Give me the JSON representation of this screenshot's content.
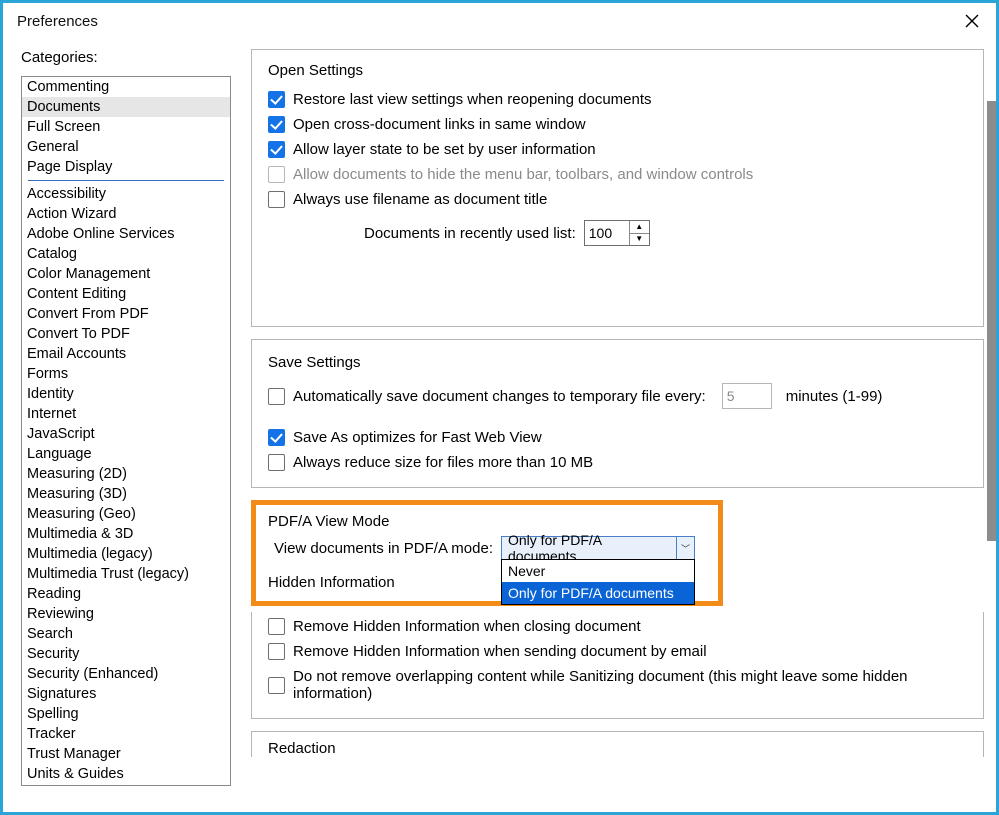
{
  "window": {
    "title": "Preferences"
  },
  "categories": {
    "label": "Categories:",
    "primary": [
      {
        "label": "Commenting"
      },
      {
        "label": "Documents",
        "selected": true
      },
      {
        "label": "Full Screen"
      },
      {
        "label": "General"
      },
      {
        "label": "Page Display"
      }
    ],
    "secondary": [
      {
        "label": "Accessibility"
      },
      {
        "label": "Action Wizard"
      },
      {
        "label": "Adobe Online Services"
      },
      {
        "label": "Catalog"
      },
      {
        "label": "Color Management"
      },
      {
        "label": "Content Editing"
      },
      {
        "label": "Convert From PDF"
      },
      {
        "label": "Convert To PDF"
      },
      {
        "label": "Email Accounts"
      },
      {
        "label": "Forms"
      },
      {
        "label": "Identity"
      },
      {
        "label": "Internet"
      },
      {
        "label": "JavaScript"
      },
      {
        "label": "Language"
      },
      {
        "label": "Measuring (2D)"
      },
      {
        "label": "Measuring (3D)"
      },
      {
        "label": "Measuring (Geo)"
      },
      {
        "label": "Multimedia & 3D"
      },
      {
        "label": "Multimedia (legacy)"
      },
      {
        "label": "Multimedia Trust (legacy)"
      },
      {
        "label": "Reading"
      },
      {
        "label": "Reviewing"
      },
      {
        "label": "Search"
      },
      {
        "label": "Security"
      },
      {
        "label": "Security (Enhanced)"
      },
      {
        "label": "Signatures"
      },
      {
        "label": "Spelling"
      },
      {
        "label": "Tracker"
      },
      {
        "label": "Trust Manager"
      },
      {
        "label": "Units & Guides"
      }
    ]
  },
  "open_settings": {
    "title": "Open Settings",
    "restore_last_view": {
      "label": "Restore last view settings when reopening documents",
      "checked": true
    },
    "cross_doc_links": {
      "label": "Open cross-document links in same window",
      "checked": true
    },
    "allow_layer_state": {
      "label": "Allow layer state to be set by user information",
      "checked": true
    },
    "allow_hide_menubar": {
      "label": "Allow documents to hide the menu bar, toolbars, and window controls",
      "checked": false,
      "disabled": true
    },
    "always_filename_title": {
      "label": "Always use filename as document title",
      "checked": false
    },
    "recent_label": "Documents in recently used list:",
    "recent_value": "100"
  },
  "save_settings": {
    "title": "Save Settings",
    "auto_save": {
      "label": "Automatically save document changes to temporary file every:",
      "checked": false
    },
    "auto_save_value": "5",
    "auto_save_minutes": "minutes (1-99)",
    "fast_web_view": {
      "label": "Save As optimizes for Fast Web View",
      "checked": true
    },
    "reduce_size": {
      "label": "Always reduce size for files more than 10 MB",
      "checked": false
    }
  },
  "pdfa": {
    "title": "PDF/A View Mode",
    "label": "View documents in PDF/A mode:",
    "selected": "Only for PDF/A documents",
    "options": [
      {
        "label": "Never"
      },
      {
        "label": "Only for PDF/A documents",
        "selected": true
      }
    ]
  },
  "hidden_info": {
    "title": "Hidden Information",
    "remove_on_close": {
      "label": "Remove Hidden Information when closing document",
      "checked": false
    },
    "remove_on_email": {
      "label": "Remove Hidden Information when sending document by email",
      "checked": false
    },
    "no_remove_overlap": {
      "label": "Do not remove overlapping content while Sanitizing document (this might leave some hidden information)",
      "checked": false
    }
  },
  "redaction": {
    "title": "Redaction"
  }
}
